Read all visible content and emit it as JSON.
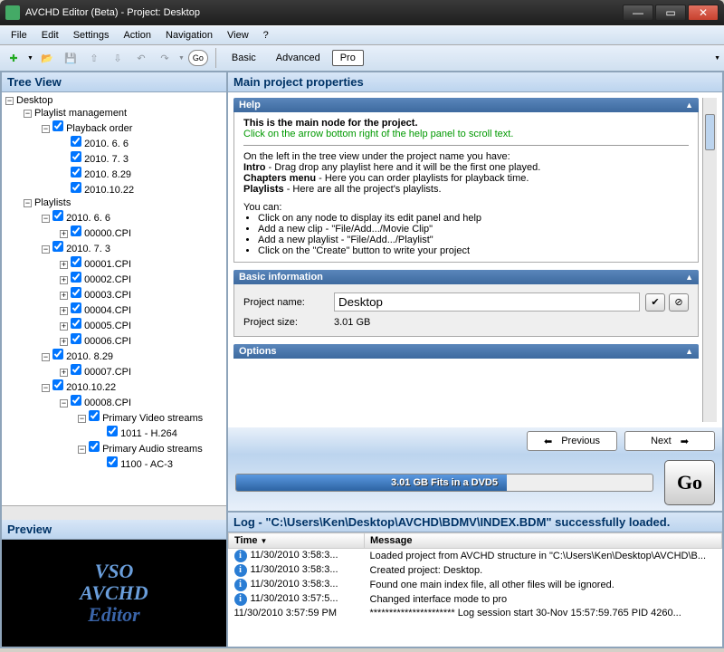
{
  "title": "AVCHD Editor (Beta) - Project: Desktop",
  "menu": [
    "File",
    "Edit",
    "Settings",
    "Action",
    "Navigation",
    "View",
    "?"
  ],
  "toolbar": {
    "go_label": "Go",
    "modes": [
      "Basic",
      "Advanced",
      "Pro"
    ],
    "selected_mode": "Pro"
  },
  "left": {
    "tree_title": "Tree View",
    "preview_title": "Preview",
    "root": "Desktop",
    "nodes": {
      "playlist_mgmt": "Playlist management",
      "playback_order": "Playback order",
      "po_items": [
        "2010. 6. 6",
        "2010. 7. 3",
        "2010. 8.29",
        "2010.10.22"
      ],
      "playlists": "Playlists",
      "pl_groups": [
        {
          "label": "2010. 6. 6",
          "items": [
            "00000.CPI"
          ]
        },
        {
          "label": "2010. 7. 3",
          "items": [
            "00001.CPI",
            "00002.CPI",
            "00003.CPI",
            "00004.CPI",
            "00005.CPI",
            "00006.CPI"
          ]
        },
        {
          "label": "2010. 8.29",
          "items": [
            "00007.CPI"
          ]
        },
        {
          "label": "2010.10.22",
          "items": [
            "00008.CPI"
          ],
          "extra": {
            "pvs": "Primary Video streams",
            "pvs_item": "1011 - H.264",
            "pas": "Primary Audio streams",
            "pas_item": "1100 - AC-3"
          }
        }
      ]
    },
    "preview_logo": {
      "line1": "VSO",
      "line2": "AVCHD",
      "line3": "Editor"
    }
  },
  "right": {
    "title": "Main project properties",
    "help": {
      "header": "Help",
      "lead": "This is the main node for the project.",
      "tip": "Click on the arrow bottom right of the help panel to scroll text.",
      "para1": "On the left in the tree view under the project name you have:",
      "intro_lbl": "Intro",
      "intro_txt": " - Drag drop any playlist here and it will be the first one played.",
      "cm_lbl": "Chapters menu",
      "cm_txt": " - Here you can order playlists for playback time.",
      "pl_lbl": "Playlists",
      "pl_txt": " - Here are all the project's playlists.",
      "youcan": "You can:",
      "bullets": [
        "Click on any node to display its edit panel and help",
        "Add a new clip - \"File/Add.../Movie Clip\"",
        "Add a new playlist - \"File/Add.../Playlist\"",
        "Click on the \"Create\" button to write your project"
      ]
    },
    "basic": {
      "header": "Basic information",
      "name_lbl": "Project name:",
      "name_val": "Desktop",
      "size_lbl": "Project size:",
      "size_val": "3.01 GB"
    },
    "options_header": "Options",
    "prev_btn": "Previous",
    "next_btn": "Next",
    "progress_text": "3.01 GB Fits in a DVD5",
    "go_btn": "Go"
  },
  "log": {
    "title": "Log - \"C:\\Users\\Ken\\Desktop\\AVCHD\\BDMV\\INDEX.BDM\" successfully loaded.",
    "col_time": "Time",
    "col_msg": "Message",
    "rows": [
      {
        "i": true,
        "t": "11/30/2010 3:58:3...",
        "m": "Loaded project from AVCHD structure in \"C:\\Users\\Ken\\Desktop\\AVCHD\\B..."
      },
      {
        "i": true,
        "t": "11/30/2010 3:58:3...",
        "m": "Created project: Desktop."
      },
      {
        "i": true,
        "t": "11/30/2010 3:58:3...",
        "m": "Found one main index file, all other files will be ignored."
      },
      {
        "i": true,
        "t": "11/30/2010 3:57:5...",
        "m": "Changed interface mode to pro"
      },
      {
        "i": false,
        "t": "11/30/2010 3:57:59 PM",
        "m": "********************** Log session start 30-Nov 15:57:59.765 PID 4260..."
      }
    ]
  }
}
